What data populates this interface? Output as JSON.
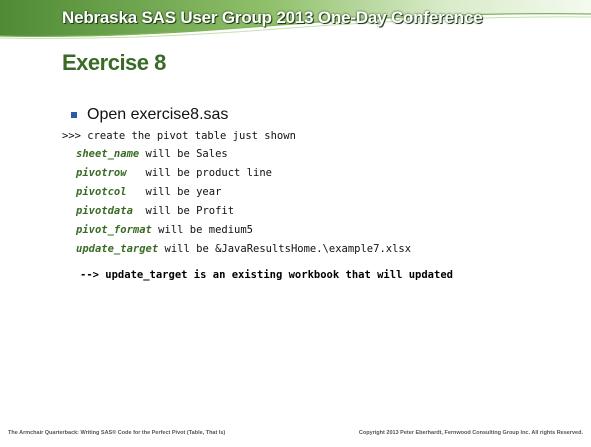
{
  "header": {
    "conference_title": "Nebraska SAS User Group 2013 One-Day Conference"
  },
  "slide": {
    "title": "Exercise 8",
    "bullet": "Open exercise8.sas",
    "prompt": ">>> create the pivot table just shown",
    "params": [
      {
        "name": "sheet_name",
        "text": " will be Sales"
      },
      {
        "name": "pivotrow",
        "text": "   will be product line"
      },
      {
        "name": "pivotcol",
        "text": "   will be year"
      },
      {
        "name": "pivotdata",
        "text": "  will be Profit"
      },
      {
        "name": "pivot_format",
        "text": " will be medium5"
      },
      {
        "name": "update_target",
        "text": " will be &JavaResultsHome.\\example7.xlsx"
      }
    ],
    "note": "--> update_target is an existing workbook that will updated"
  },
  "footer": {
    "left": "The Armchair Quarterback: Writing SAS® Code for the Perfect Pivot (Table, That Is)",
    "right": "Copyright 2013 Peter Eberhardt, Fernwood Consulting Group Inc. All rights Reserved."
  },
  "colors": {
    "accent_green": "#3a6b26",
    "bullet_blue": "#2a5aa8"
  }
}
